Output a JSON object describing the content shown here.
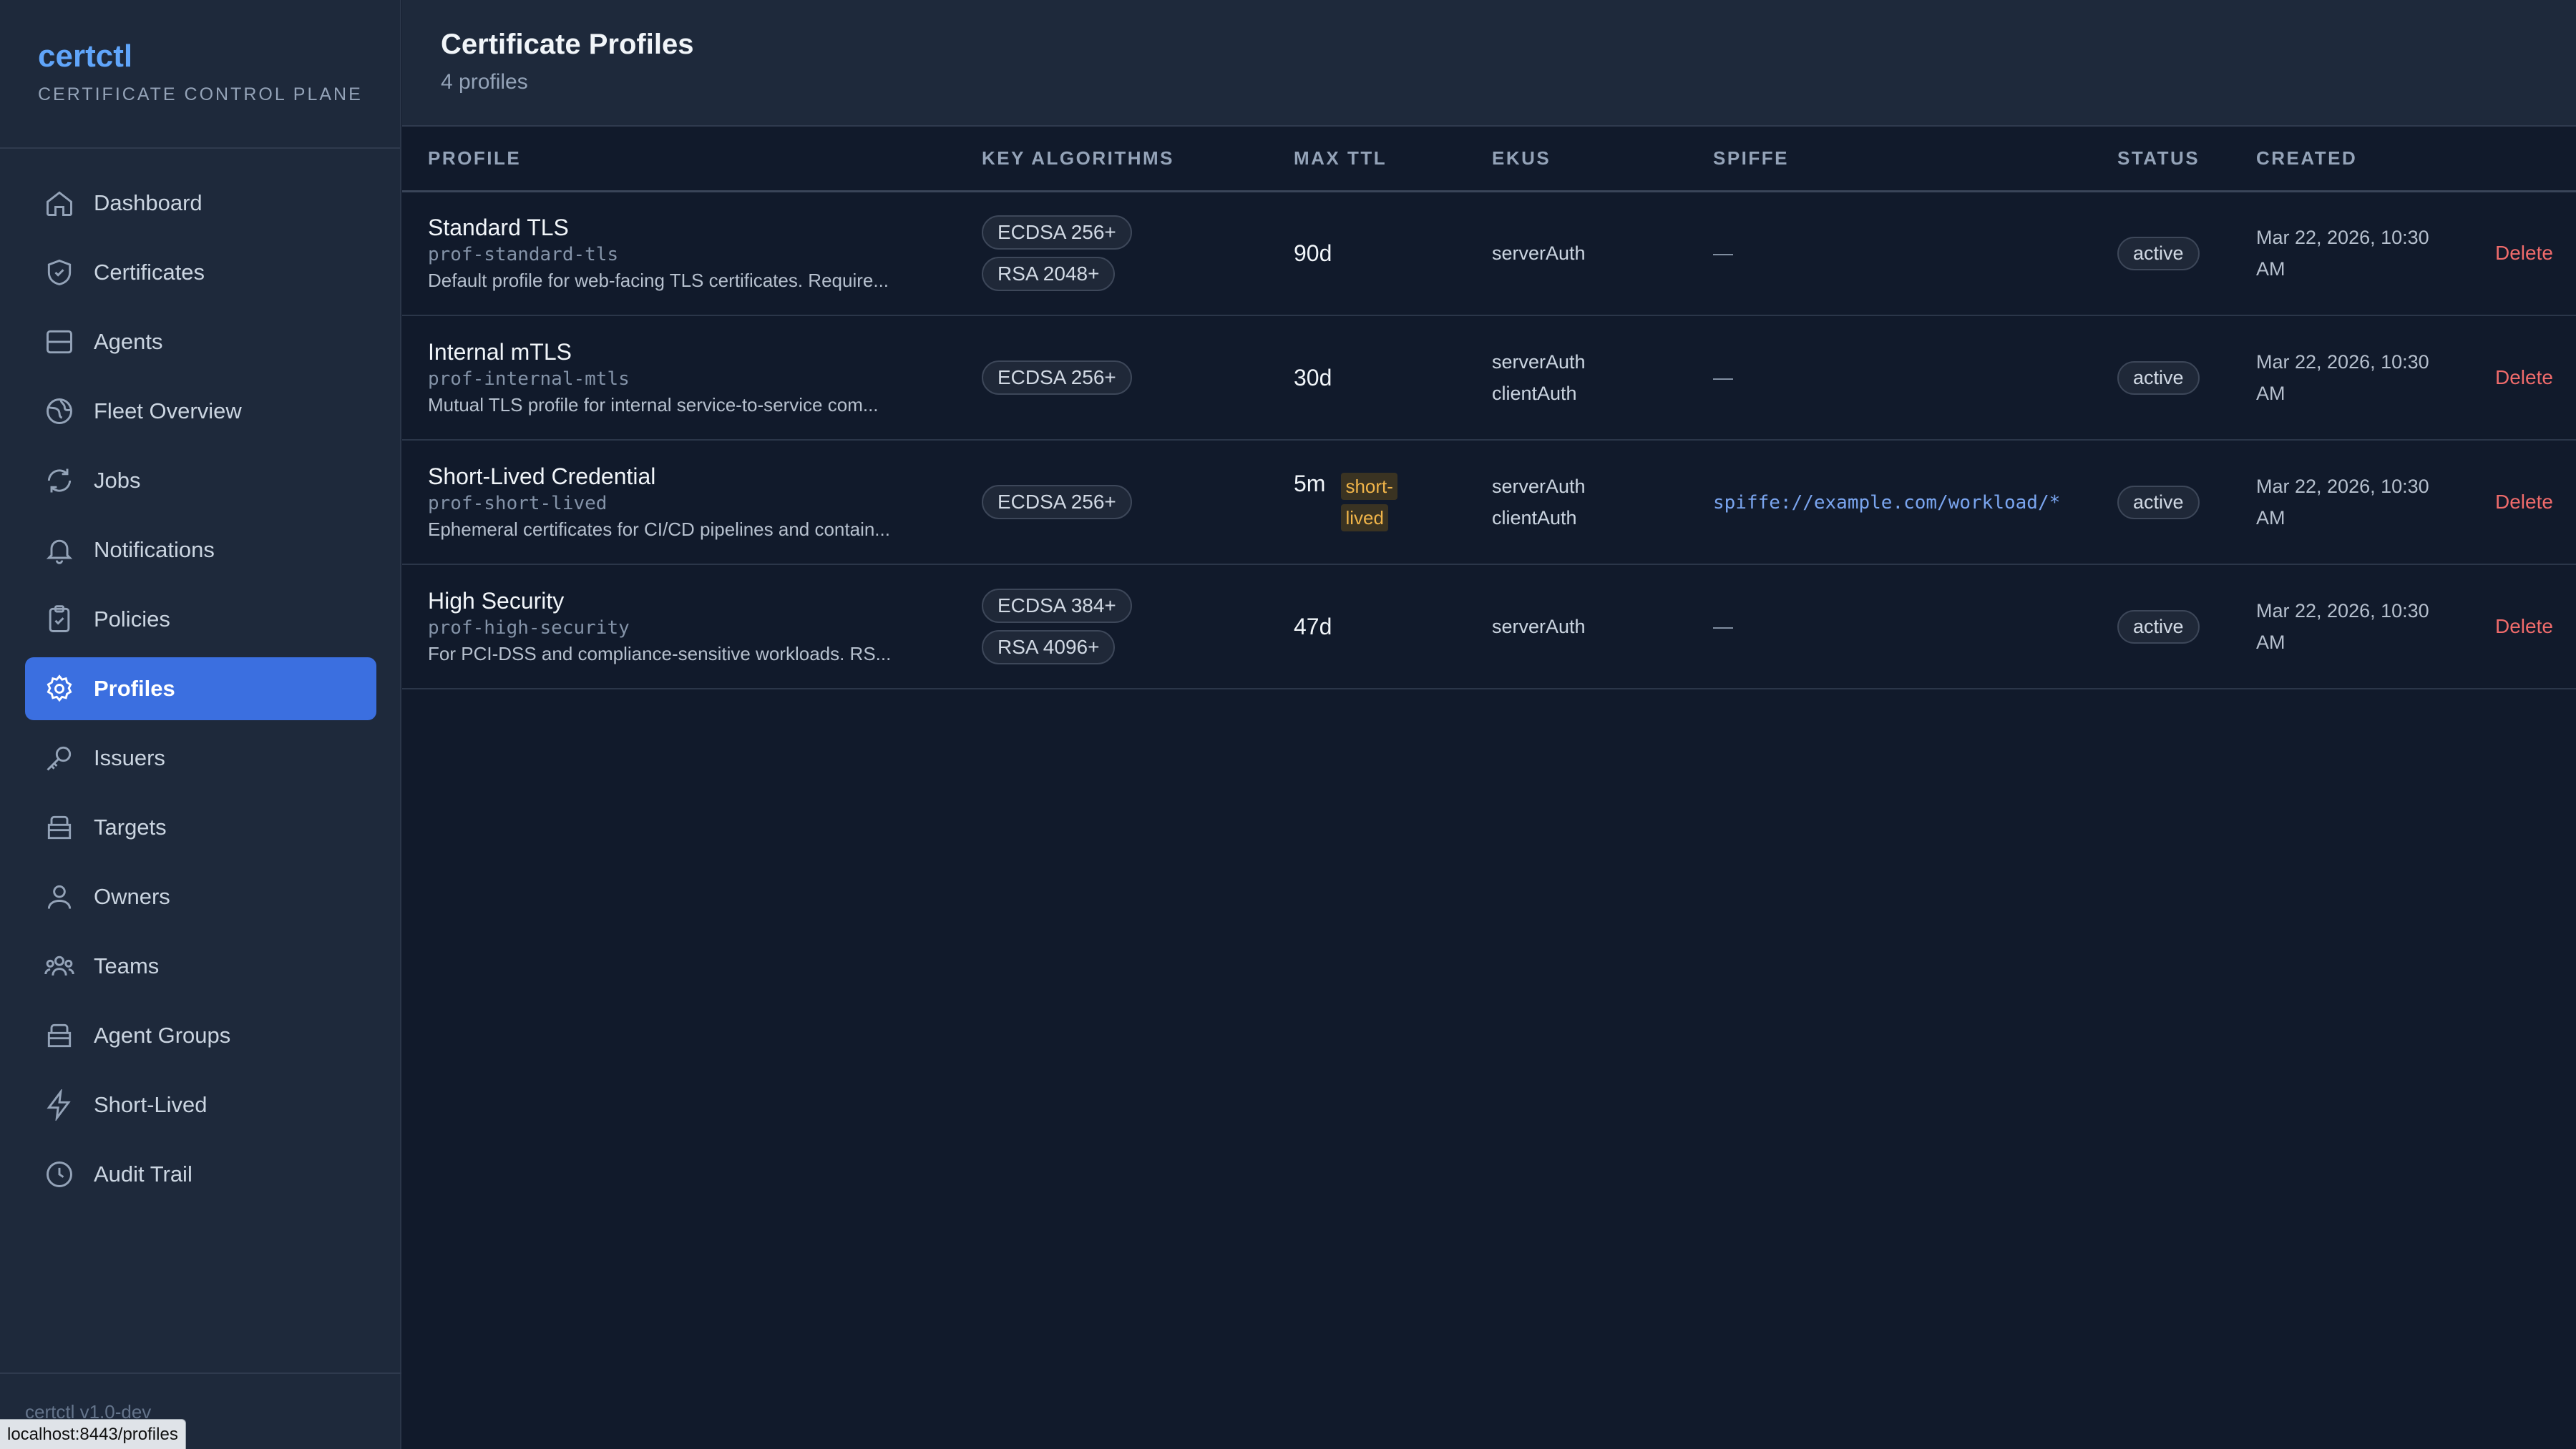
{
  "app": {
    "name": "certctl",
    "tagline": "CERTIFICATE CONTROL PLANE",
    "version": "certctl v1.0-dev"
  },
  "status_url": "localhost:8443/profiles",
  "sidebar": {
    "items": [
      {
        "label": "Dashboard",
        "icon": "home-icon"
      },
      {
        "label": "Certificates",
        "icon": "shield-icon"
      },
      {
        "label": "Agents",
        "icon": "server-icon"
      },
      {
        "label": "Fleet Overview",
        "icon": "globe-icon"
      },
      {
        "label": "Jobs",
        "icon": "refresh-icon"
      },
      {
        "label": "Notifications",
        "icon": "bell-icon"
      },
      {
        "label": "Policies",
        "icon": "clipboard-check-icon"
      },
      {
        "label": "Profiles",
        "icon": "gear-icon",
        "active": true
      },
      {
        "label": "Issuers",
        "icon": "key-icon"
      },
      {
        "label": "Targets",
        "icon": "box-icon"
      },
      {
        "label": "Owners",
        "icon": "user-icon"
      },
      {
        "label": "Teams",
        "icon": "users-icon"
      },
      {
        "label": "Agent Groups",
        "icon": "box-icon"
      },
      {
        "label": "Short-Lived",
        "icon": "bolt-icon"
      },
      {
        "label": "Audit Trail",
        "icon": "clock-icon"
      }
    ]
  },
  "header": {
    "title": "Certificate Profiles",
    "subtitle": "4 profiles"
  },
  "table": {
    "columns": [
      "PROFILE",
      "KEY ALGORITHMS",
      "MAX TTL",
      "EKUS",
      "SPIFFE",
      "STATUS",
      "CREATED",
      ""
    ],
    "rows": [
      {
        "name": "Standard TLS",
        "id": "prof-standard-tls",
        "desc": "Default profile for web-facing TLS certificates. Require...",
        "algos": [
          "ECDSA 256+",
          "RSA 2048+"
        ],
        "ttl": "90d",
        "ttl_badge": "",
        "ekus": [
          "serverAuth"
        ],
        "spiffe": "—",
        "status": "active",
        "created_1": "Mar 22, 2026, 10:30",
        "created_2": "AM",
        "action": "Delete"
      },
      {
        "name": "Internal mTLS",
        "id": "prof-internal-mtls",
        "desc": "Mutual TLS profile for internal service-to-service com...",
        "algos": [
          "ECDSA 256+"
        ],
        "ttl": "30d",
        "ttl_badge": "",
        "ekus": [
          "serverAuth",
          "clientAuth"
        ],
        "spiffe": "—",
        "status": "active",
        "created_1": "Mar 22, 2026, 10:30",
        "created_2": "AM",
        "action": "Delete"
      },
      {
        "name": "Short-Lived Credential",
        "id": "prof-short-lived",
        "desc": "Ephemeral certificates for CI/CD pipelines and contain...",
        "algos": [
          "ECDSA 256+"
        ],
        "ttl": "5m",
        "ttl_badge_1": "short-",
        "ttl_badge_2": "lived",
        "ekus": [
          "serverAuth",
          "clientAuth"
        ],
        "spiffe": "spiffe://example.com/workload/*",
        "status": "active",
        "created_1": "Mar 22, 2026, 10:30",
        "created_2": "AM",
        "action": "Delete"
      },
      {
        "name": "High Security",
        "id": "prof-high-security",
        "desc": "For PCI-DSS and compliance-sensitive workloads. RS...",
        "algos": [
          "ECDSA 384+",
          "RSA 4096+"
        ],
        "ttl": "47d",
        "ttl_badge": "",
        "ekus": [
          "serverAuth"
        ],
        "spiffe": "—",
        "status": "active",
        "created_1": "Mar 22, 2026, 10:30",
        "created_2": "AM",
        "action": "Delete"
      }
    ]
  }
}
